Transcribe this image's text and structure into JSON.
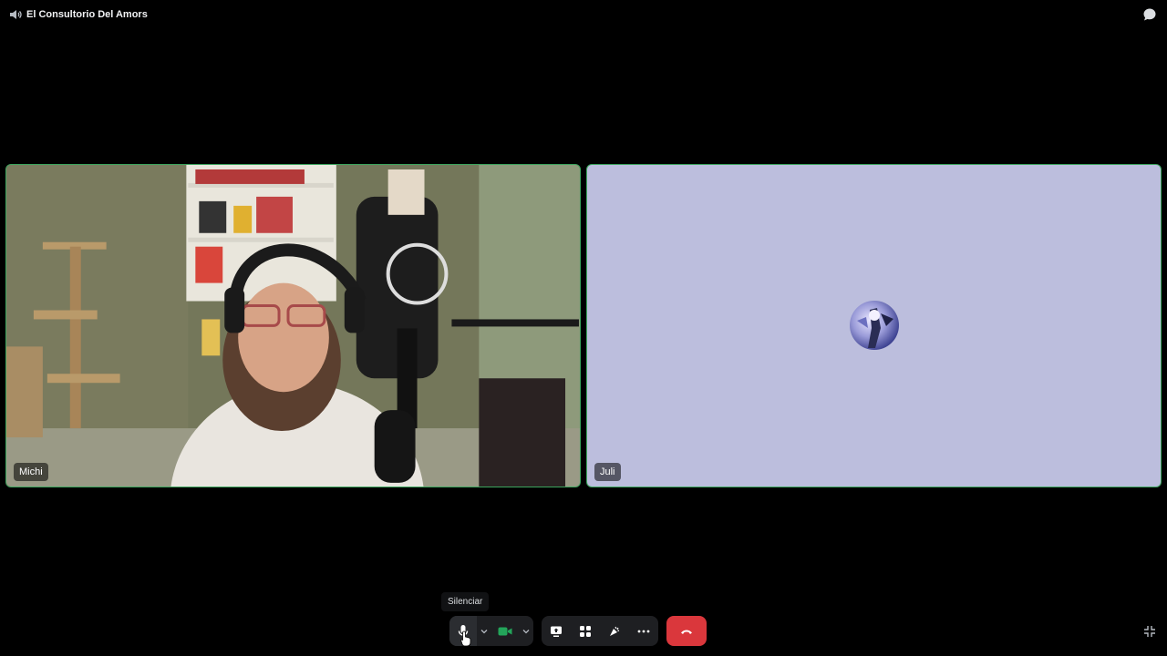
{
  "header": {
    "channel_name": "El Consultorio Del Amors",
    "channel_icon": "speaker-icon",
    "chat_icon": "chat-bubble-icon"
  },
  "participants": [
    {
      "name": "Michi",
      "video": "on"
    },
    {
      "name": "Juli",
      "video": "off",
      "avatar": "avatar-image"
    }
  ],
  "tooltip": {
    "text": "Silenciar"
  },
  "controls": {
    "mic_icon": "microphone-icon",
    "camera_icon": "video-camera-icon",
    "screen_share_icon": "screen-share-icon",
    "activities_icon": "activities-icon",
    "soundboard_icon": "soundboard-icon",
    "more_icon": "more-icon",
    "leave_icon": "hang-up-icon",
    "collapse_icon": "collapse-icon"
  },
  "colors": {
    "speaking_border": "#3ba55d",
    "leave_red": "#da373c",
    "camera_green": "#23a55a",
    "juli_tile_bg": "#bcbedd"
  }
}
